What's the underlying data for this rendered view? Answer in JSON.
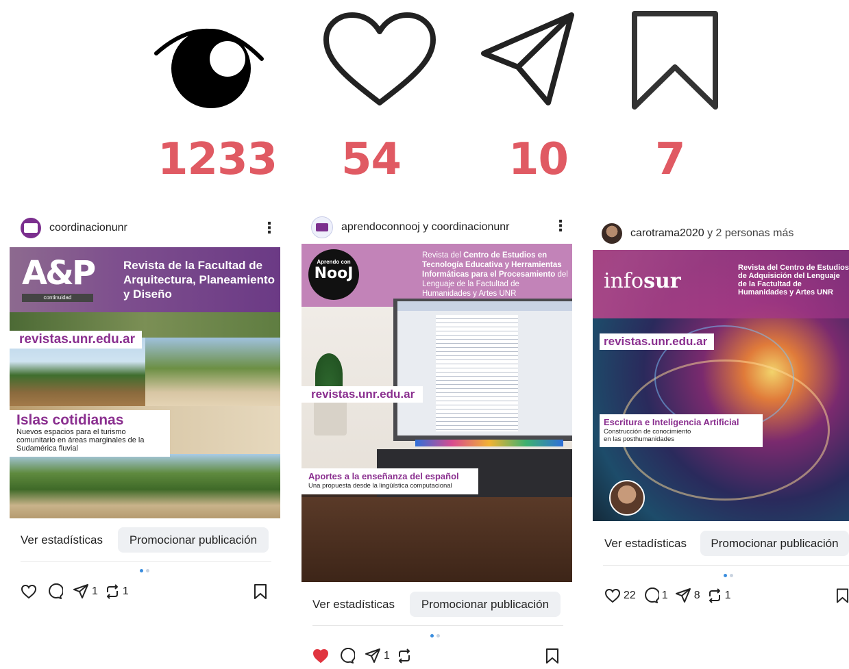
{
  "stats": {
    "views": {
      "icon": "eye-icon",
      "value": "1233"
    },
    "likes": {
      "icon": "heart-icon",
      "value": "54"
    },
    "shares": {
      "icon": "send-icon",
      "value": "10"
    },
    "saves": {
      "icon": "bookmark-icon",
      "value": "7"
    }
  },
  "accent_color": "#e05a63",
  "posts": [
    {
      "author": "coordinacionunr",
      "image": {
        "logo": "A&P",
        "logo_sub": "continuidad",
        "headline": "Revista de la Facultad de Arquitectura, Planeamiento y Diseño",
        "url": "revistas.unr.edu.ar",
        "title": "Islas cotidianas",
        "subtitle": "Nuevos espacios para el turismo comunitario en áreas marginales de la Sudamérica fluvial"
      },
      "stats_label": "Ver estadísticas",
      "promote_label": "Promocionar publicación",
      "likes": "",
      "comments": "",
      "shares": "1",
      "reposts": "1",
      "liked": false
    },
    {
      "author_a": "aprendoconnooj",
      "author_join": " y ",
      "author_b": "coordinacionunr",
      "image": {
        "badge_top": "Aprendo con",
        "badge_main": "NooJ",
        "headline_pre": "Revista del ",
        "headline_bold": "Centro de Estudios en Tecnología Educativa y Herramientas Informáticas para el Procesamiento",
        "headline_post": " del Lenguaje de la Factultad de Humanidades y Artes UNR",
        "url": "revistas.unr.edu.ar",
        "title": "Aportes a la enseñanza del español",
        "subtitle": "Una propuesta desde la lingüística computacional"
      },
      "stats_label": "Ver estadísticas",
      "promote_label": "Promocionar publicación",
      "likes": "",
      "comments": "",
      "shares": "1",
      "reposts": "",
      "liked": true
    },
    {
      "author_a": "carotrama2020",
      "author_join": " y 2 personas más",
      "image": {
        "logo_a": "info",
        "logo_b": "sur",
        "headline": "Revista del Centro de Estudios de Adquisición del Lenguaje de la Factultad de Humanidades y Artes UNR",
        "url": "revistas.unr.edu.ar",
        "title": "Escritura e Inteligencia Artificial",
        "subtitle": "Construcción de conocimiento en las posthumanidades"
      },
      "stats_label": "Ver estadísticas",
      "promote_label": "Promocionar publicación",
      "likes": "22",
      "comments": "1",
      "shares": "8",
      "reposts": "1",
      "liked": false
    }
  ]
}
